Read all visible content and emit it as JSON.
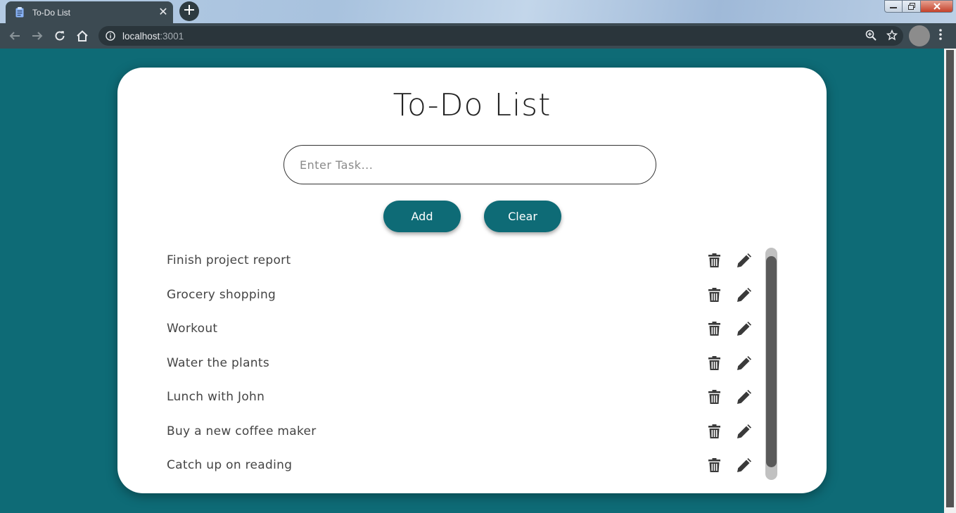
{
  "browser": {
    "tab_title": "To-Do List",
    "url_host": "localhost",
    "url_port": ":3001"
  },
  "app": {
    "title": "To-Do List",
    "input_placeholder": "Enter Task...",
    "add_label": "Add",
    "clear_label": "Clear",
    "tasks": [
      "Finish project report",
      "Grocery shopping",
      "Workout",
      "Water the plants",
      "Lunch with John",
      "Buy a new coffee maker",
      "Catch up on reading"
    ]
  },
  "colors": {
    "accent": "#0e6b76",
    "icon": "#3a3a3a"
  }
}
